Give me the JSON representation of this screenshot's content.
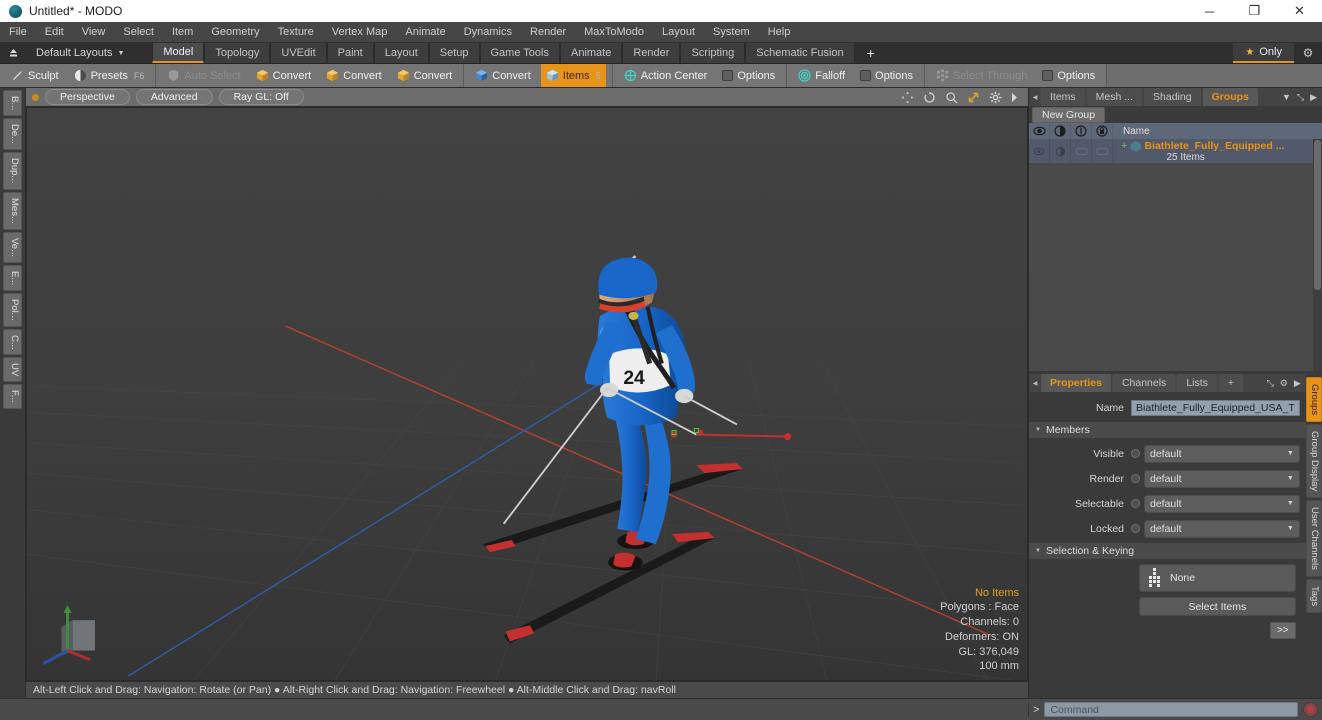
{
  "titlebar": {
    "title": "Untitled* - MODO",
    "app_icon": "modo-orb-icon",
    "minimize": "─",
    "maximize": "❐",
    "close": "✕"
  },
  "menubar": {
    "items": [
      "File",
      "Edit",
      "View",
      "Select",
      "Item",
      "Geometry",
      "Texture",
      "Vertex Map",
      "Animate",
      "Dynamics",
      "Render",
      "MaxToModo",
      "Layout",
      "System",
      "Help"
    ]
  },
  "layoutbar": {
    "upload_icon": "export-icon",
    "layouts_label": "Default Layouts",
    "caret": "▼",
    "tabs": [
      {
        "label": "Model",
        "active": true
      },
      {
        "label": "Topology",
        "active": false
      },
      {
        "label": "UVEdit",
        "active": false
      },
      {
        "label": "Paint",
        "active": false
      },
      {
        "label": "Layout",
        "active": false
      },
      {
        "label": "Setup",
        "active": false
      },
      {
        "label": "Game Tools",
        "active": false
      },
      {
        "label": "Animate",
        "active": false
      },
      {
        "label": "Render",
        "active": false
      },
      {
        "label": "Scripting",
        "active": false
      },
      {
        "label": "Schematic Fusion",
        "active": false
      }
    ],
    "add_tab": "+",
    "only_label": "Only",
    "only_star": "★",
    "gear": "⚙",
    "accent": "#e8941a"
  },
  "toolbar": {
    "groups": [
      {
        "items": [
          {
            "label": "Sculpt",
            "icon": "brush-icon",
            "state": "normal",
            "key": ""
          },
          {
            "label": "Presets",
            "icon": "sphere-half-icon",
            "state": "normal",
            "key": "F6"
          }
        ]
      },
      {
        "items": [
          {
            "label": "Auto Select",
            "icon": "shield-icon",
            "state": "dim",
            "key": ""
          },
          {
            "label": "Convert",
            "icon": "cube-yellow-icon",
            "state": "normal",
            "key": ""
          },
          {
            "label": "Convert",
            "icon": "cube-yellow-icon",
            "state": "normal",
            "key": ""
          },
          {
            "label": "Convert",
            "icon": "cube-yellow-icon",
            "state": "normal",
            "key": ""
          }
        ]
      },
      {
        "items": [
          {
            "label": "Convert",
            "icon": "cube-blue-icon",
            "state": "normal",
            "key": ""
          },
          {
            "label": "Items",
            "icon": "cube-orange-icon",
            "state": "active",
            "key": "5"
          }
        ]
      },
      {
        "items": [
          {
            "label": "Action Center",
            "icon": "crosshair-icon",
            "state": "normal",
            "key": ""
          },
          {
            "label": "Options",
            "icon": "checkbox-icon",
            "state": "normal",
            "key": ""
          }
        ]
      },
      {
        "items": [
          {
            "label": "Falloff",
            "icon": "target-icon",
            "state": "normal",
            "key": ""
          },
          {
            "label": "Options",
            "icon": "checkbox-icon",
            "state": "normal",
            "key": ""
          }
        ]
      },
      {
        "items": [
          {
            "label": "Select Through",
            "icon": "dots-grid-icon",
            "state": "dim",
            "key": ""
          },
          {
            "label": "Options",
            "icon": "checkbox-icon",
            "state": "normal",
            "key": ""
          }
        ]
      }
    ]
  },
  "left_tabs": [
    "B...",
    "De...",
    "Dup...",
    "Mes...",
    "Ve...",
    "E...",
    "Pol...",
    "C...",
    "UV",
    "F..."
  ],
  "viewport": {
    "header": {
      "dot": "viewport-state-dot",
      "pills": [
        "Perspective",
        "Advanced",
        "Ray GL: Off"
      ],
      "nav_icons": [
        "pan-icon",
        "rotate-icon",
        "zoom-icon",
        "fit-icon",
        "gear-icon",
        "chevron-right-icon"
      ]
    },
    "stats": [
      {
        "text": "No Items",
        "highlight": true
      },
      {
        "text": "Polygons : Face",
        "highlight": false
      },
      {
        "text": "Channels: 0",
        "highlight": false
      },
      {
        "text": "Deformers: ON",
        "highlight": false
      },
      {
        "text": "GL: 376,049",
        "highlight": false
      },
      {
        "text": "100 mm",
        "highlight": false
      }
    ],
    "axis_gizmo": "axis-gizmo",
    "model": {
      "subject": "biathlete-3d-model",
      "bib_number": "24"
    }
  },
  "statusbar": {
    "hints": "Alt-Left Click and Drag: Navigation: Rotate (or Pan)  ●  Alt-Right Click and Drag: Navigation: Freewheel  ●  Alt-Middle Click and Drag: navRoll"
  },
  "items_panel": {
    "tabs": [
      {
        "label": "Items",
        "active": false
      },
      {
        "label": "Mesh ...",
        "active": false
      },
      {
        "label": "Shading",
        "active": false
      },
      {
        "label": "Groups",
        "active": true
      }
    ],
    "tab_menu": "▼",
    "expand_icon": "expand-icon",
    "more_icon": "▶",
    "new_group_label": "New Group",
    "columns": [
      {
        "name": "visibility-column",
        "icon": "eye-icon"
      },
      {
        "name": "render-column",
        "icon": "render-icon"
      },
      {
        "name": "selectable-column",
        "icon": "selectable-icon"
      },
      {
        "name": "locked-column",
        "icon": "lock-icon"
      },
      {
        "name": "name-column",
        "label": "Name"
      }
    ],
    "rows": [
      {
        "name": "Biathlete_Fully_Equipped ...",
        "sub": "25 Items",
        "expander": "+",
        "icon": "group-icon"
      }
    ]
  },
  "properties_panel": {
    "tabs": [
      {
        "label": "Properties",
        "active": true
      },
      {
        "label": "Channels",
        "active": false
      },
      {
        "label": "Lists",
        "active": false
      },
      {
        "label": "+",
        "active": false
      }
    ],
    "expand_icon": "expand-icon",
    "gear_icon": "⚙",
    "more_icon": "▶",
    "name_label": "Name",
    "name_value": "Biathlete_Fully_Equipped_USA_T",
    "sections": [
      {
        "title": "Members",
        "rows": [
          {
            "label": "Visible",
            "value": "default"
          },
          {
            "label": "Render",
            "value": "default"
          },
          {
            "label": "Selectable",
            "value": "default"
          },
          {
            "label": "Locked",
            "value": "default"
          }
        ]
      },
      {
        "title": "Selection & Keying",
        "none_field": "None",
        "none_icon": "dots-figure-icon",
        "select_items_label": "Select Items",
        "goto_label": ">>"
      }
    ]
  },
  "right_tabs": [
    {
      "label": "Groups",
      "active": true
    },
    {
      "label": "Group Display",
      "active": false
    },
    {
      "label": "User Channels",
      "active": false
    },
    {
      "label": "Tags",
      "active": false
    }
  ],
  "command_bar": {
    "prompt": ">",
    "placeholder": "Command",
    "value": "",
    "record_button": "record-icon"
  },
  "colors": {
    "accent_orange": "#e8941a",
    "panel_bg": "#3a3a3a",
    "toolbar_bg": "#6e6e6e",
    "tree_header": "#5e6878",
    "field_blue": "#94a0ae",
    "axis_x": "#c0392b",
    "axis_z": "#2d5fa8",
    "suit_blue": "#1766c8"
  }
}
